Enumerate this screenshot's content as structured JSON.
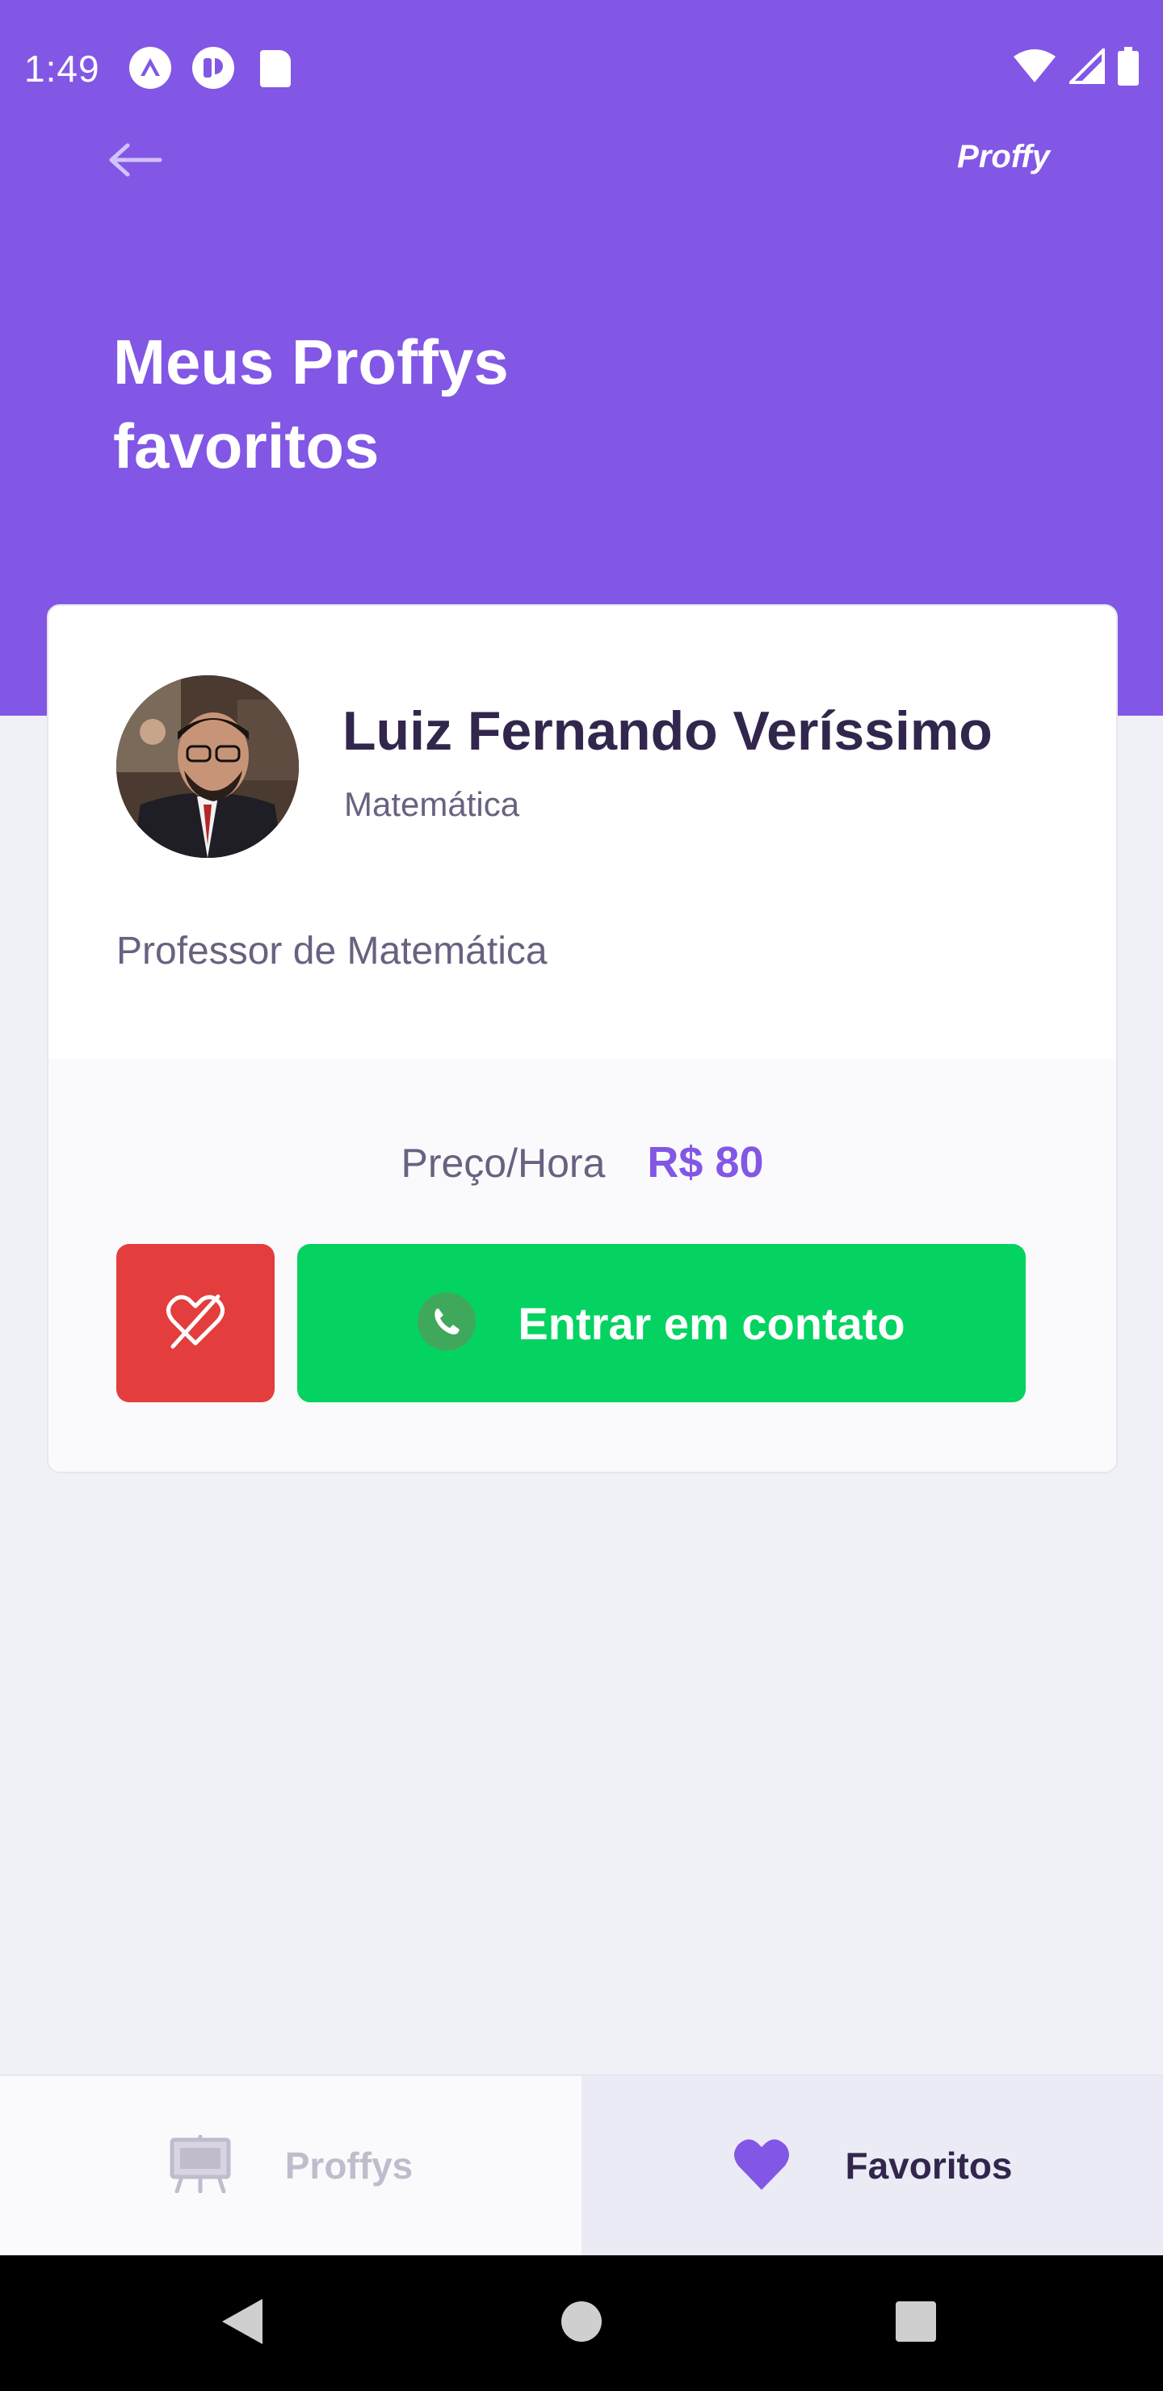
{
  "status_bar": {
    "time": "1:49",
    "notification_icons": [
      "expo-icon",
      "app-icon",
      "sd-card-icon"
    ],
    "system_icons": [
      "wifi-icon",
      "cell-signal-icon",
      "battery-icon"
    ]
  },
  "top_bar": {
    "back_icon": "arrow-left-icon",
    "brand": "Proffy"
  },
  "page": {
    "title_line1": "Meus Proffys",
    "title_line2": "favoritos"
  },
  "teacher_card": {
    "name": "Luiz Fernando Veríssimo",
    "subject": "Matemática",
    "bio": "Professor de Matemática",
    "price_label": "Preço/Hora",
    "price_value": "R$ 80",
    "unfavorite_icon": "heart-outline-crossed-icon",
    "contact_icon": "whatsapp-icon",
    "contact_label": "Entrar em contato"
  },
  "tabs": [
    {
      "label": "Proffys",
      "icon": "easel-icon",
      "active": false
    },
    {
      "label": "Favoritos",
      "icon": "heart-icon",
      "active": true
    }
  ],
  "colors": {
    "primary": "#8257E5",
    "background": "#F0F0F7",
    "title_text": "#32264D",
    "body_text": "#6A6180",
    "danger": "#E33D3D",
    "whatsapp": "#04D361",
    "inactive_tab": "#C1BCCC"
  }
}
